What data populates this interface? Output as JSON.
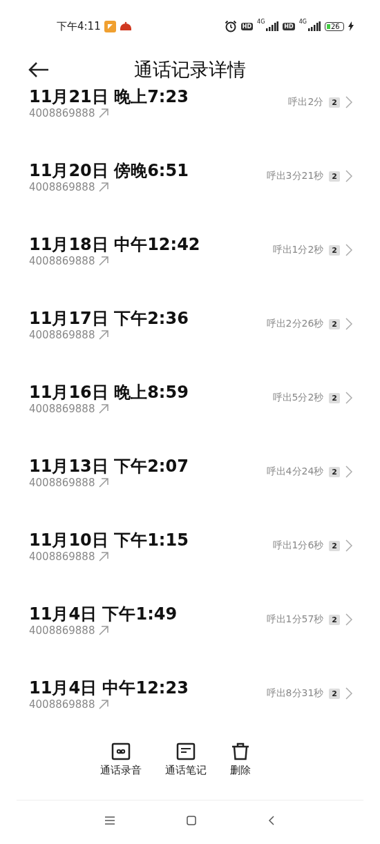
{
  "status_bar": {
    "time": "下午4:11",
    "sims": [
      {
        "hd": "HD",
        "network": "4G"
      },
      {
        "hd": "HD",
        "network": "4G"
      }
    ],
    "battery": "26",
    "charging": true
  },
  "header": {
    "title": "通话记录详情"
  },
  "calls": [
    {
      "datetime": "11月21日 晚上7:23",
      "number": "4008869888",
      "duration": "呼出2分",
      "count": "2"
    },
    {
      "datetime": "11月20日 傍晚6:51",
      "number": "4008869888",
      "duration": "呼出3分21秒",
      "count": "2"
    },
    {
      "datetime": "11月18日 中午12:42",
      "number": "4008869888",
      "duration": "呼出1分2秒",
      "count": "2"
    },
    {
      "datetime": "11月17日 下午2:36",
      "number": "4008869888",
      "duration": "呼出2分26秒",
      "count": "2"
    },
    {
      "datetime": "11月16日 晚上8:59",
      "number": "4008869888",
      "duration": "呼出5分2秒",
      "count": "2"
    },
    {
      "datetime": "11月13日 下午2:07",
      "number": "4008869888",
      "duration": "呼出4分24秒",
      "count": "2"
    },
    {
      "datetime": "11月10日 下午1:15",
      "number": "4008869888",
      "duration": "呼出1分6秒",
      "count": "2"
    },
    {
      "datetime": "11月4日 下午1:49",
      "number": "4008869888",
      "duration": "呼出1分57秒",
      "count": "2"
    },
    {
      "datetime": "11月4日 中午12:23",
      "number": "4008869888",
      "duration": "呼出8分31秒",
      "count": "2"
    }
  ],
  "actions": [
    {
      "kind": "recording",
      "label": "通话录音"
    },
    {
      "kind": "notes",
      "label": "通话笔记"
    },
    {
      "kind": "delete",
      "label": "删除"
    }
  ]
}
